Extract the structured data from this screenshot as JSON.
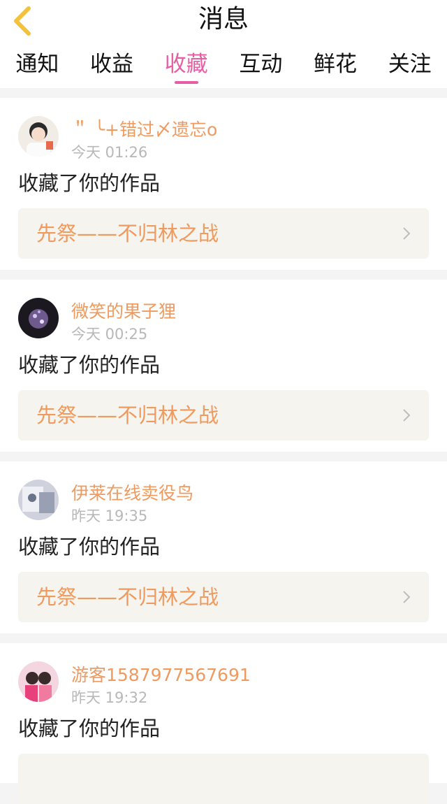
{
  "header": {
    "title": "消息"
  },
  "tabs": [
    {
      "label": "通知"
    },
    {
      "label": "收益"
    },
    {
      "label": "收藏",
      "active": true
    },
    {
      "label": "互动"
    },
    {
      "label": "鲜花"
    },
    {
      "label": "关注"
    }
  ],
  "colors": {
    "accent": "#e85ea4",
    "username": "#ef9a5f",
    "time": "#b8b8b8"
  },
  "notifications": [
    {
      "user": "＂ ╰+错过〆遗忘o",
      "time": "今天 01:26",
      "action": "收藏了你的作品",
      "work": "先祭——不归林之战"
    },
    {
      "user": "微笑的果子狸",
      "time": "今天 00:25",
      "action": "收藏了你的作品",
      "work": "先祭——不归林之战"
    },
    {
      "user": "伊莱在线卖役鸟",
      "time": "昨天 19:35",
      "action": "收藏了你的作品",
      "work": "先祭——不归林之战"
    },
    {
      "user": "游客1587977567691",
      "time": "昨天 19:32",
      "action": "收藏了你的作品"
    }
  ]
}
